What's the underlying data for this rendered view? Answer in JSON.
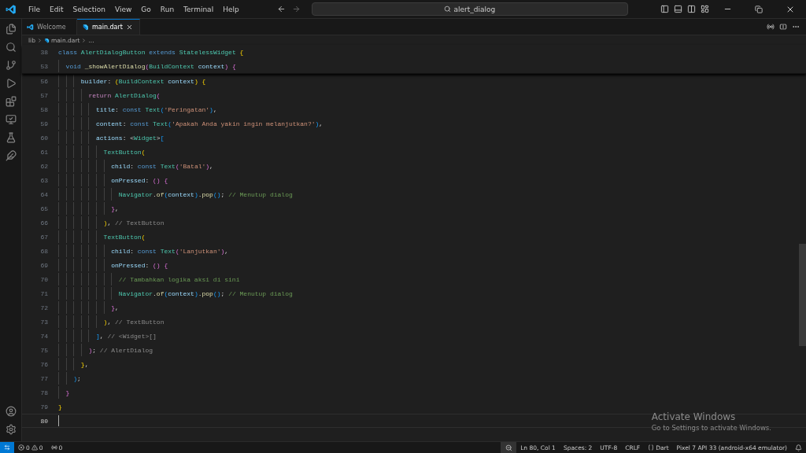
{
  "menu": [
    "File",
    "Edit",
    "Selection",
    "View",
    "Go",
    "Run",
    "Terminal",
    "Help"
  ],
  "search": {
    "value": "alert_dialog"
  },
  "tabs": [
    {
      "label": "Welcome",
      "kind": "vscode",
      "selected": false
    },
    {
      "label": "main.dart",
      "kind": "dart",
      "selected": true
    }
  ],
  "breadcrumbs": [
    "lib",
    "main.dart",
    "..."
  ],
  "sticky_lines": [
    {
      "number": "38",
      "code": "class AlertDialogButton extends StatelessWidget {"
    },
    {
      "number": "53",
      "code": "  void _showAlertDialog(BuildContext context) {"
    }
  ],
  "lines": [
    {
      "number": "56",
      "current": false,
      "code": "      builder: (BuildContext context) {"
    },
    {
      "number": "57",
      "current": false,
      "code": "        return AlertDialog("
    },
    {
      "number": "58",
      "current": false,
      "code": "          title: const Text('Peringatan'),"
    },
    {
      "number": "59",
      "current": false,
      "code": "          content: const Text('Apakah Anda yakin ingin melanjutkan?'),"
    },
    {
      "number": "60",
      "current": false,
      "code": "          actions: <Widget>["
    },
    {
      "number": "61",
      "current": false,
      "code": "            TextButton("
    },
    {
      "number": "62",
      "current": false,
      "code": "              child: const Text('Batal'),"
    },
    {
      "number": "63",
      "current": false,
      "code": "              onPressed: () {"
    },
    {
      "number": "64",
      "current": false,
      "code": "                Navigator.of(context).pop(); // Menutup dialog"
    },
    {
      "number": "65",
      "current": false,
      "code": "              },"
    },
    {
      "number": "66",
      "current": false,
      "code": "            ),",
      "label": "// TextButton"
    },
    {
      "number": "67",
      "current": false,
      "code": "            TextButton("
    },
    {
      "number": "68",
      "current": false,
      "code": "              child: const Text('Lanjutkan'),"
    },
    {
      "number": "69",
      "current": false,
      "code": "              onPressed: () {"
    },
    {
      "number": "70",
      "current": false,
      "code": "                // Tambahkan logika aksi di sini"
    },
    {
      "number": "71",
      "current": false,
      "code": "                Navigator.of(context).pop(); // Menutup dialog"
    },
    {
      "number": "72",
      "current": false,
      "code": "              },"
    },
    {
      "number": "73",
      "current": false,
      "code": "            ),",
      "label": "// TextButton"
    },
    {
      "number": "74",
      "current": false,
      "code": "          ],",
      "label": "// <Widget>[]"
    },
    {
      "number": "75",
      "current": false,
      "code": "        );",
      "label": "// AlertDialog"
    },
    {
      "number": "76",
      "current": false,
      "code": "      },"
    },
    {
      "number": "77",
      "current": false,
      "code": "    );"
    },
    {
      "number": "78",
      "current": false,
      "code": "  }"
    },
    {
      "number": "79",
      "current": false,
      "code": "}"
    },
    {
      "number": "80",
      "current": true
    }
  ],
  "watermark": {
    "title": "Activate Windows",
    "subtitle": "Go to Settings to activate Windows."
  },
  "status_bar": {
    "errors": "0",
    "warnings": "0",
    "ports": "0",
    "items": [
      {
        "kind": "zoom"
      },
      {
        "kind": "text",
        "label": "Ln 80, Col 1"
      },
      {
        "kind": "text",
        "label": "Spaces: 2"
      },
      {
        "kind": "text",
        "label": "UTF-8"
      },
      {
        "kind": "text",
        "label": "CRLF"
      },
      {
        "kind": "language",
        "label": "Dart"
      },
      {
        "kind": "text",
        "label": "Pixel 7 API 33 (android-x64 emulator)"
      },
      {
        "kind": "bell"
      }
    ]
  }
}
